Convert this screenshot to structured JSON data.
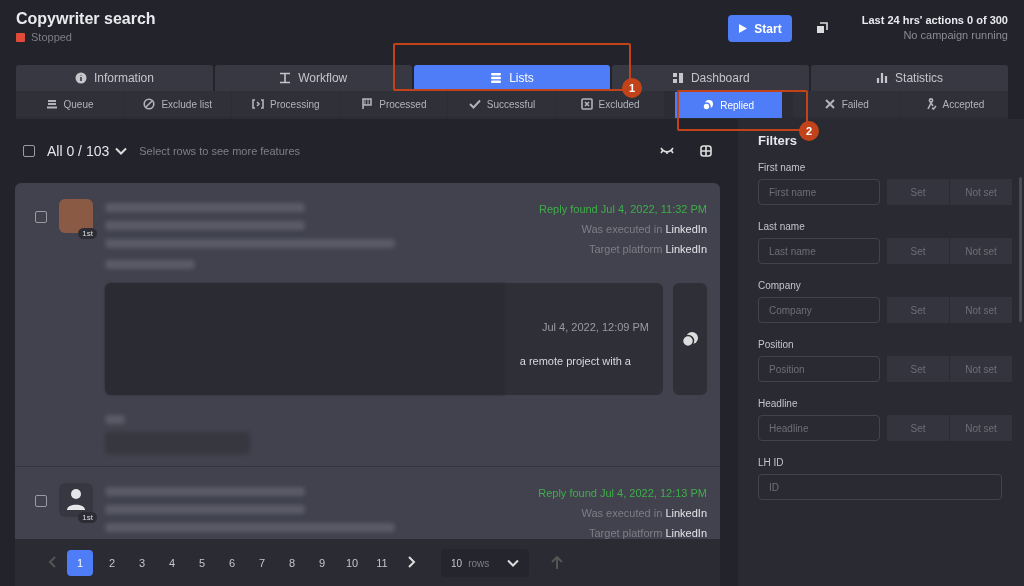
{
  "header": {
    "title": "Copywriter search",
    "status": "Stopped",
    "start_button": "Start",
    "actions": "Last 24 hrs' actions 0 of 300",
    "campaign": "No campaign running"
  },
  "tabs": [
    {
      "label": "Information",
      "selected": false
    },
    {
      "label": "Workflow",
      "selected": false
    },
    {
      "label": "Lists",
      "selected": true
    },
    {
      "label": "Dashboard",
      "selected": false
    },
    {
      "label": "Statistics",
      "selected": false
    }
  ],
  "subtabs": [
    {
      "label": "Queue",
      "selected": false
    },
    {
      "label": "Exclude list",
      "selected": false
    },
    {
      "label": "Processing",
      "selected": false
    },
    {
      "label": "Processed",
      "selected": false
    },
    {
      "label": "Successful",
      "selected": false
    },
    {
      "label": "Excluded",
      "selected": false
    },
    {
      "label": "Replied",
      "selected": true
    },
    {
      "label": "Failed",
      "selected": false
    },
    {
      "label": "Accepted",
      "selected": false
    }
  ],
  "toolbar": {
    "checked": false,
    "count": "All 0 / 103",
    "hint": "Select rows to see more features"
  },
  "rows": [
    {
      "kind": "photo",
      "checked": false,
      "degree": "1st",
      "reply": "Reply found Jul 4, 2022, 11:32 PM",
      "executed_label": "Was executed in",
      "executed": "LinkedIn",
      "platform_label": "Target platform",
      "platform": "LinkedIn",
      "message": {
        "date": "Jul 4, 2022, 12:09 PM",
        "text": "a remote project with a"
      }
    },
    {
      "kind": "silhouette",
      "checked": false,
      "degree": "1st",
      "reply": "Reply found Jul 4, 2022, 12:13 PM",
      "executed_label": "Was executed in",
      "executed": "LinkedIn",
      "platform_label": "Target platform",
      "platform": "LinkedIn"
    }
  ],
  "pagination": {
    "pages": [
      {
        "label": "1",
        "selected": true
      },
      {
        "label": "2",
        "selected": false
      },
      {
        "label": "3",
        "selected": false
      },
      {
        "label": "4",
        "selected": false
      },
      {
        "label": "5",
        "selected": false
      },
      {
        "label": "6",
        "selected": false
      },
      {
        "label": "7",
        "selected": false
      },
      {
        "label": "8",
        "selected": false
      },
      {
        "label": "9",
        "selected": false
      },
      {
        "label": "10",
        "selected": false
      },
      {
        "label": "11",
        "selected": false
      }
    ],
    "rows_value": "10",
    "rows_label": "rows"
  },
  "filters": {
    "title": "Filters",
    "items": [
      {
        "kind": "toggle",
        "label": "First name",
        "placeholder": "First name",
        "set": "Set",
        "not_set": "Not set"
      },
      {
        "kind": "toggle",
        "label": "Last name",
        "placeholder": "Last name",
        "set": "Set",
        "not_set": "Not set"
      },
      {
        "kind": "toggle",
        "label": "Company",
        "placeholder": "Company",
        "set": "Set",
        "not_set": "Not set"
      },
      {
        "kind": "toggle",
        "label": "Position",
        "placeholder": "Position",
        "set": "Set",
        "not_set": "Not set"
      },
      {
        "kind": "toggle",
        "label": "Headline",
        "placeholder": "Headline",
        "set": "Set",
        "not_set": "Not set"
      },
      {
        "kind": "plain",
        "label": "LH ID",
        "placeholder": "ID"
      }
    ]
  },
  "annotations": [
    {
      "label": "1"
    },
    {
      "label": "2"
    }
  ]
}
